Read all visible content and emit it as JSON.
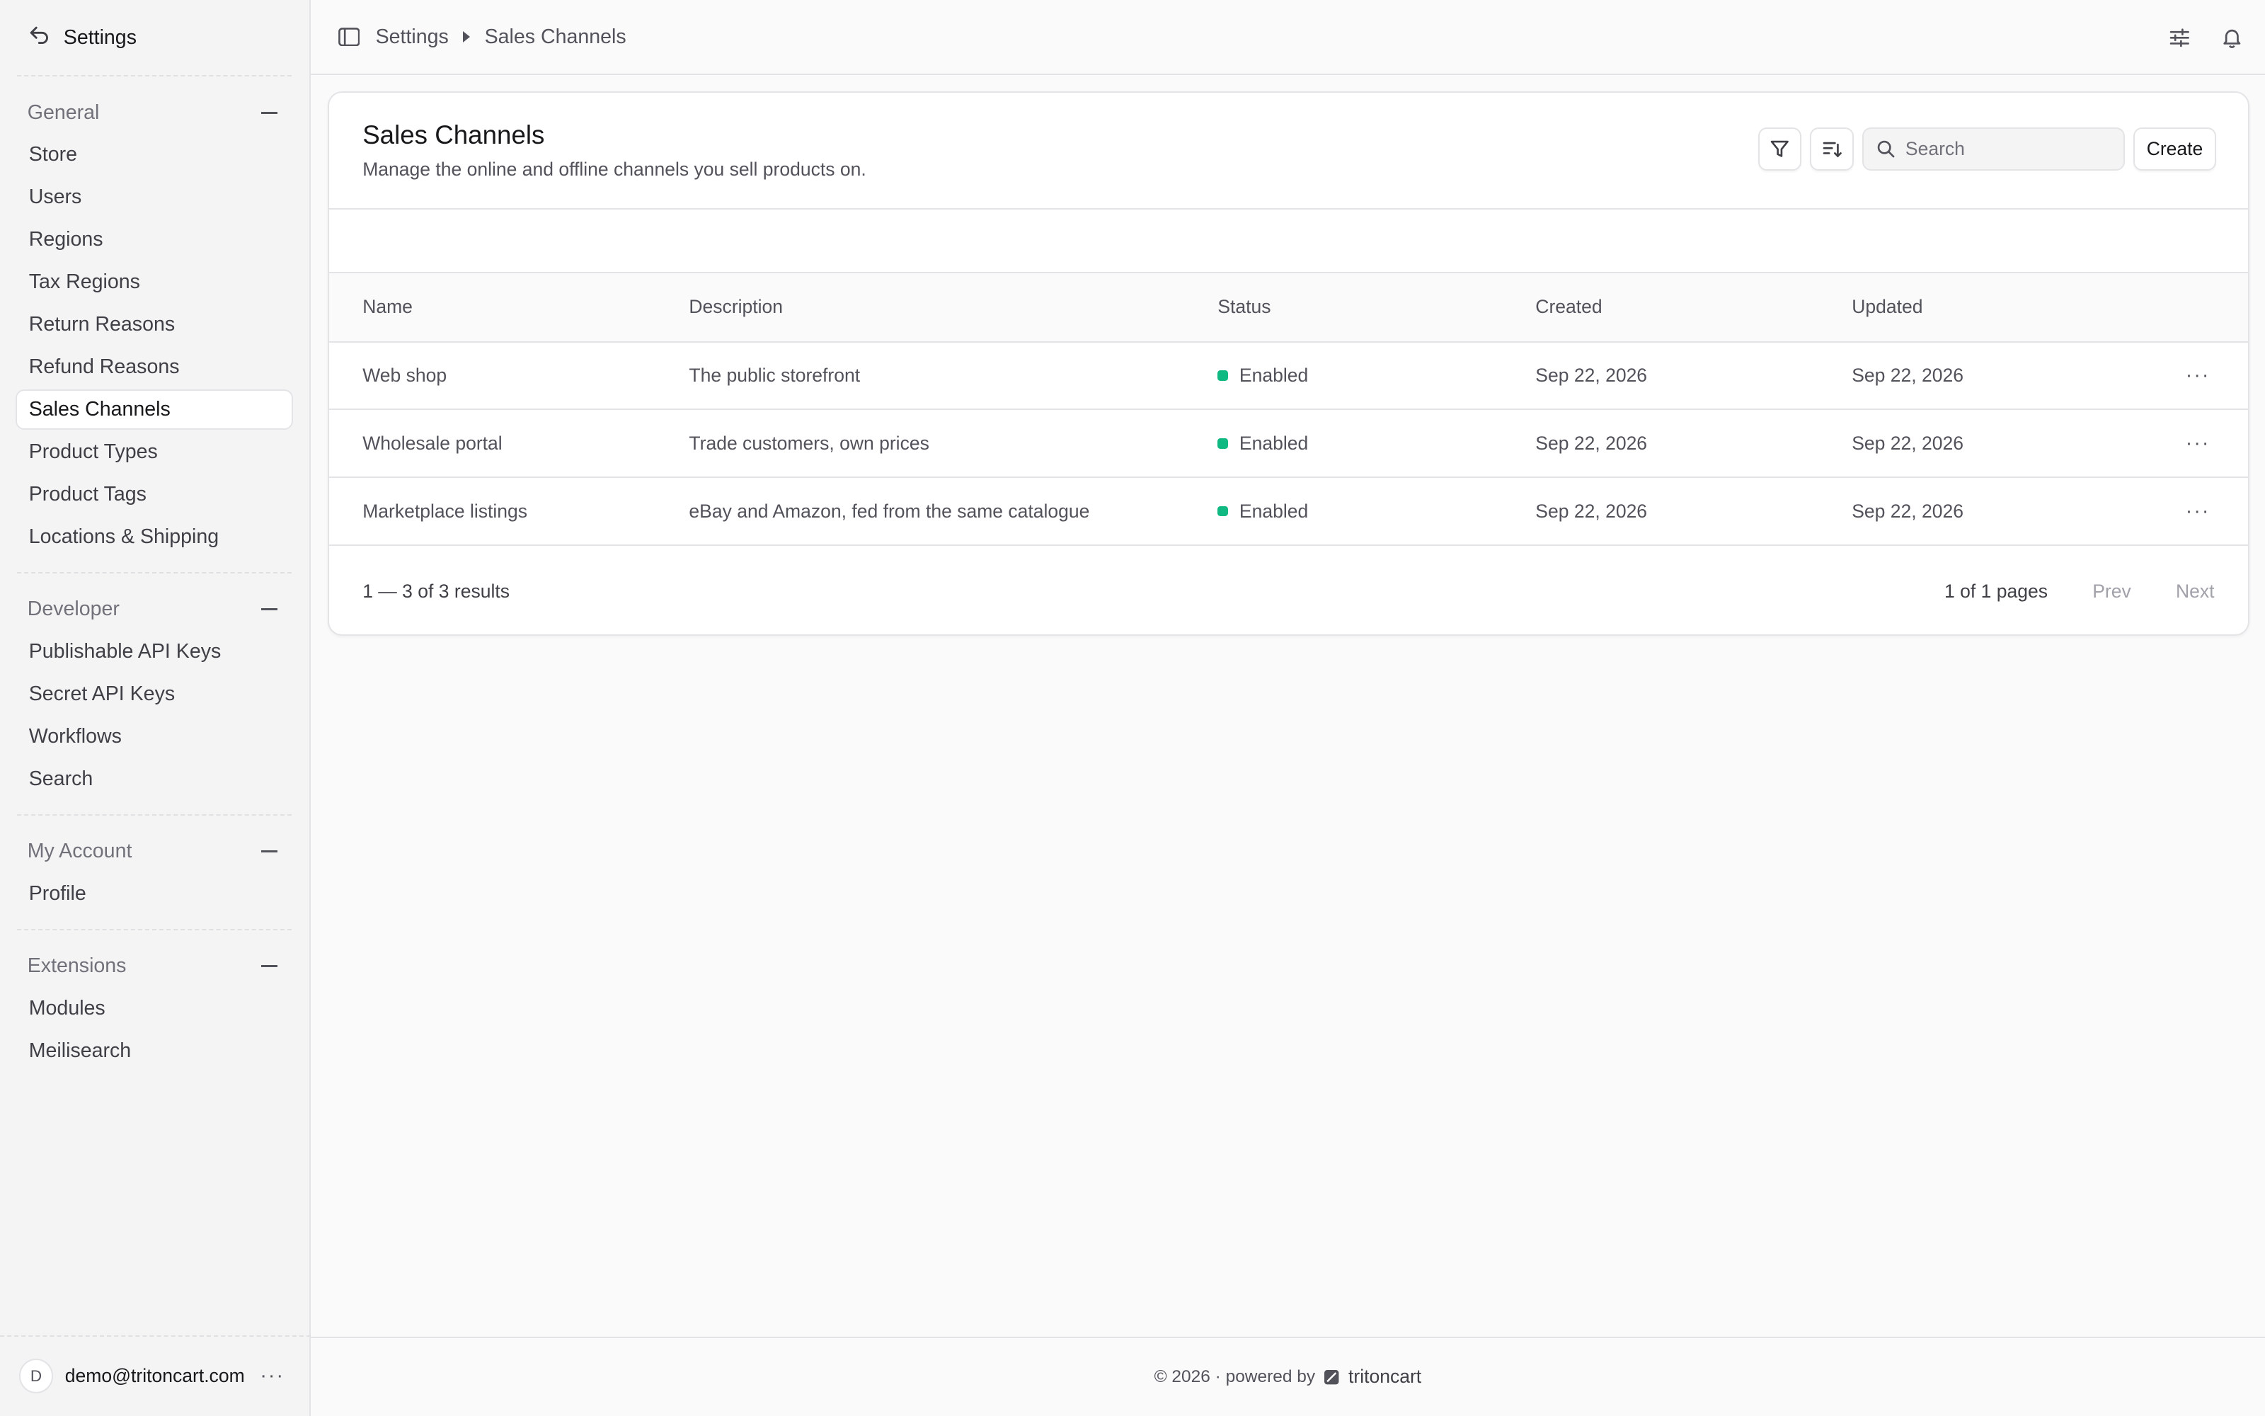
{
  "sidebar": {
    "title": "Settings",
    "sections": [
      {
        "label": "General",
        "items": [
          "Store",
          "Users",
          "Regions",
          "Tax Regions",
          "Return Reasons",
          "Refund Reasons",
          "Sales Channels",
          "Product Types",
          "Product Tags",
          "Locations & Shipping"
        ]
      },
      {
        "label": "Developer",
        "items": [
          "Publishable API Keys",
          "Secret API Keys",
          "Workflows",
          "Search"
        ]
      },
      {
        "label": "My Account",
        "items": [
          "Profile"
        ]
      },
      {
        "label": "Extensions",
        "items": [
          "Modules",
          "Meilisearch"
        ]
      }
    ],
    "active_item": "Sales Channels",
    "user": {
      "initial": "D",
      "email": "demo@tritoncart.com"
    }
  },
  "topbar": {
    "breadcrumb": [
      "Settings",
      "Sales Channels"
    ]
  },
  "card": {
    "title": "Sales Channels",
    "subtitle": "Manage the online and offline channels you sell products on.",
    "search_placeholder": "Search",
    "create_label": "Create"
  },
  "table": {
    "columns": [
      "Name",
      "Description",
      "Status",
      "Created",
      "Updated"
    ],
    "rows": [
      {
        "name": "Web shop",
        "description": "The public storefront",
        "status": "Enabled",
        "created": "Sep 22, 2026",
        "updated": "Sep 22, 2026"
      },
      {
        "name": "Wholesale portal",
        "description": "Trade customers, own prices",
        "status": "Enabled",
        "created": "Sep 22, 2026",
        "updated": "Sep 22, 2026"
      },
      {
        "name": "Marketplace listings",
        "description": "eBay and Amazon, fed from the same catalogue",
        "status": "Enabled",
        "created": "Sep 22, 2026",
        "updated": "Sep 22, 2026"
      }
    ],
    "status_color": "#10b981"
  },
  "pagination": {
    "results": "1 — 3 of 3 results",
    "pages": "1 of 1 pages",
    "prev": "Prev",
    "next": "Next"
  },
  "footer": {
    "text": "© 2026 · powered by",
    "brand": "tritoncart"
  }
}
